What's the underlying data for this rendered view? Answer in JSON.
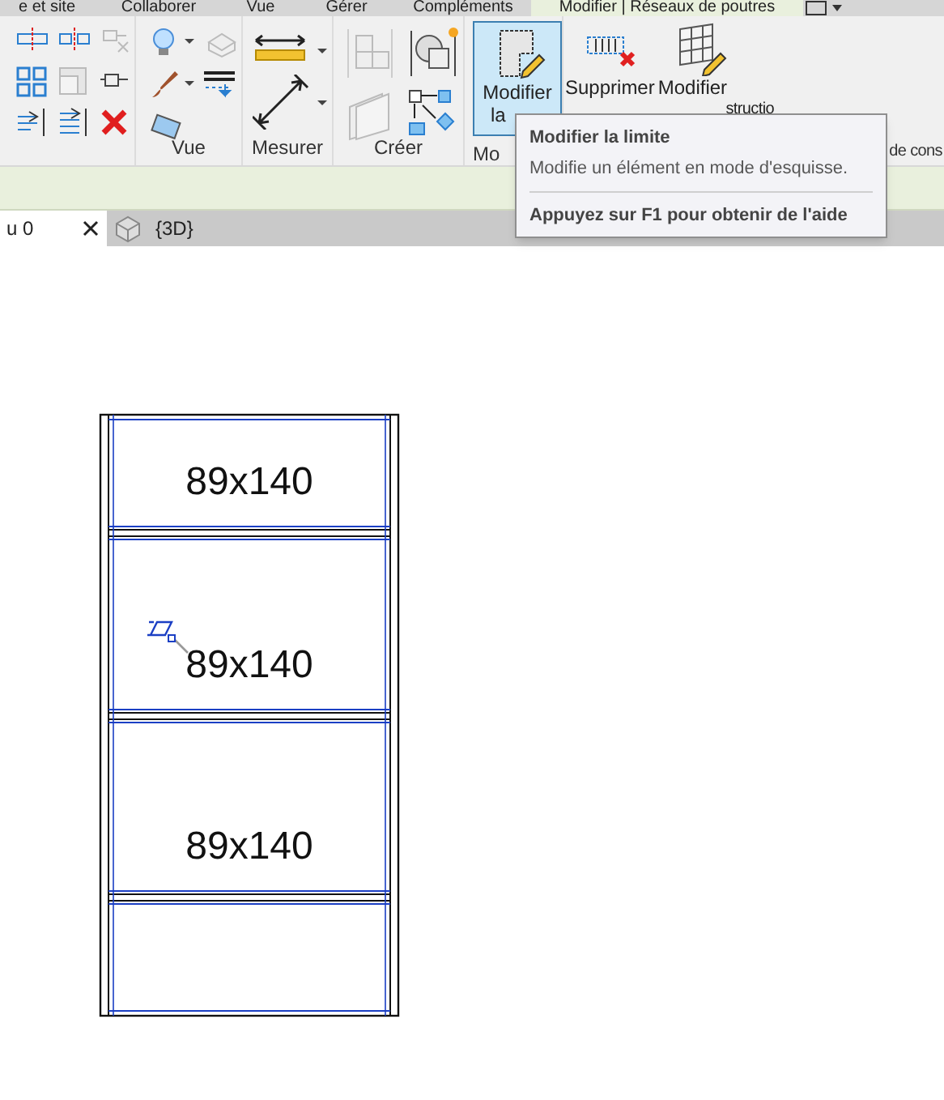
{
  "ribbon_tabs": [
    {
      "label": "e et site",
      "selected": false
    },
    {
      "label": "Collaborer",
      "selected": false
    },
    {
      "label": "Vue",
      "selected": false
    },
    {
      "label": "Gérer",
      "selected": false
    },
    {
      "label": "Compléments",
      "selected": false
    },
    {
      "label": "Modifier | Réseaux de poutres",
      "selected": true
    }
  ],
  "ribbon_panels": [
    {
      "label": "Vue"
    },
    {
      "label": "Mesurer"
    },
    {
      "label": "Créer"
    },
    {
      "label": "Mo"
    },
    {
      "label": "de cons"
    }
  ],
  "large_buttons": [
    {
      "lines": [
        "Modifier",
        "la"
      ],
      "selected": true
    },
    {
      "lines": [
        "Supprimer"
      ],
      "selected": false
    },
    {
      "lines": [
        "Modifier",
        "structio"
      ],
      "selected": false
    }
  ],
  "tooltip": {
    "title": "Modifier la limite",
    "description": "Modifie un élément en mode d'esquisse.",
    "help": "Appuyez sur F1 pour obtenir de l'aide"
  },
  "view_tabs": [
    {
      "label": "u 0",
      "selected": true,
      "closable": true
    },
    {
      "label": "{3D}",
      "selected": false,
      "closable": false
    }
  ],
  "canvas": {
    "beam_labels": [
      "89x140",
      "89x140",
      "89x140"
    ]
  }
}
